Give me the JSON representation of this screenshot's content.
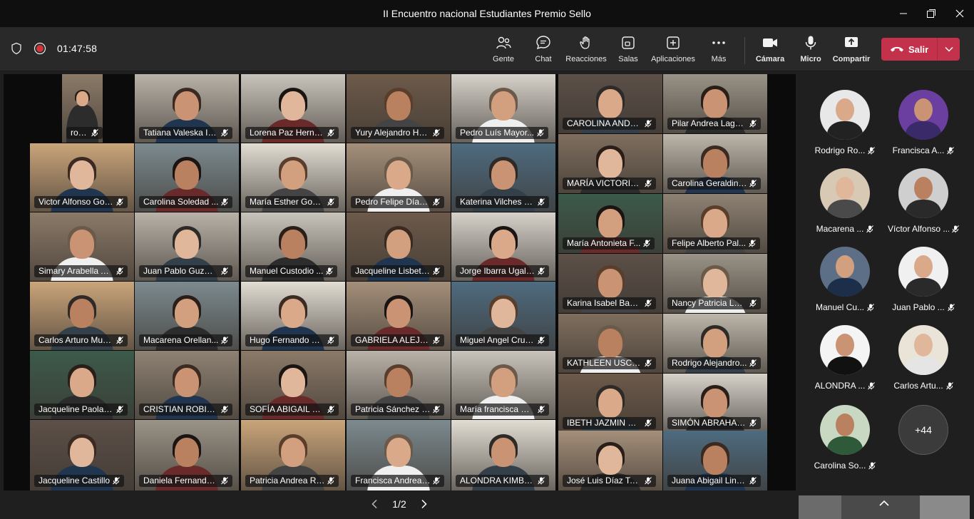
{
  "window": {
    "title": "II Encuentro nacional Estudiantes Premio Sello"
  },
  "toolbar": {
    "timer": "01:47:58",
    "buttons": [
      {
        "label": "Gente",
        "icon": "people-icon"
      },
      {
        "label": "Chat",
        "icon": "chat-icon"
      },
      {
        "label": "Reacciones",
        "icon": "reactions-icon"
      },
      {
        "label": "Salas",
        "icon": "rooms-icon"
      },
      {
        "label": "Aplicaciones",
        "icon": "apps-icon"
      },
      {
        "label": "Más",
        "icon": "more-icon"
      },
      {
        "label": "Cámara",
        "icon": "camera-icon"
      },
      {
        "label": "Micro",
        "icon": "microphone-icon"
      },
      {
        "label": "Compartir",
        "icon": "share-icon"
      }
    ],
    "leave_label": "Salir",
    "leave_color": "#c4314b"
  },
  "grid": {
    "tiles": [
      "rolando",
      "Tatiana Valeska Iv...",
      "Lorena Paz Herna...",
      "Yury Alejandro He...",
      "Pedro Luís Mayor...",
      "CAROLINA ANDRE...",
      "Pilar Andrea Lagos...",
      "Victor Alfonso Gonz...",
      "Carolina Soledad ...",
      "María Esther Gomez ...",
      "Pedro Felipe Díaz ...",
      "Katerina Vilches M...",
      "MARÍA VICTORIA ...",
      "Carolina Geraldine...",
      "María Antonieta F...",
      "Felipe Alberto Pal...",
      "Simary Arabella Al...",
      "Juan Pablo Guzma...",
      "Manuel Custodio ...",
      "Jacqueline Lisbeth...",
      "Jorge Ibarra Ugalde",
      "Karina Isabel Bakx ...",
      "Nancy Patricia Lor...",
      "Carlos Arturo Mus...",
      "Macarena Orellan...",
      "Hugo Fernando Fe...",
      "GABRIELA ALEJAN...",
      "Miguel Angel Cruz...",
      "KATHLEEN USCHY...",
      "Rodrigo Alejandro...",
      "Jacqueline Paola J...",
      "CRISTIAN ROBINS...",
      "SOFÍA ABIGAIL FA...",
      "Patricia Sánchez F...",
      "María francisca Or...",
      "IBETH JAZMIN HE...",
      "SIMÓN ABRAHAM...",
      "Jacqueline Castillo",
      "Daniela Fernanda ...",
      "Patricia Andrea Ro...",
      "Francisca Andrea ...",
      "ALONDRA KIMBE...",
      "José Luis Díaz Torr...",
      "Juana Abigail Linc..."
    ],
    "page": "1/2"
  },
  "panel": {
    "people": [
      "Rodrigo Ro...",
      "Francisca A...",
      "Macarena ...",
      "Víctor Alfonso ...",
      "Manuel Cu...",
      "Juan Pablo ...",
      "ALONDRA ...",
      "Carlos Artu...",
      "Carolina So..."
    ],
    "more_count": "+44"
  }
}
